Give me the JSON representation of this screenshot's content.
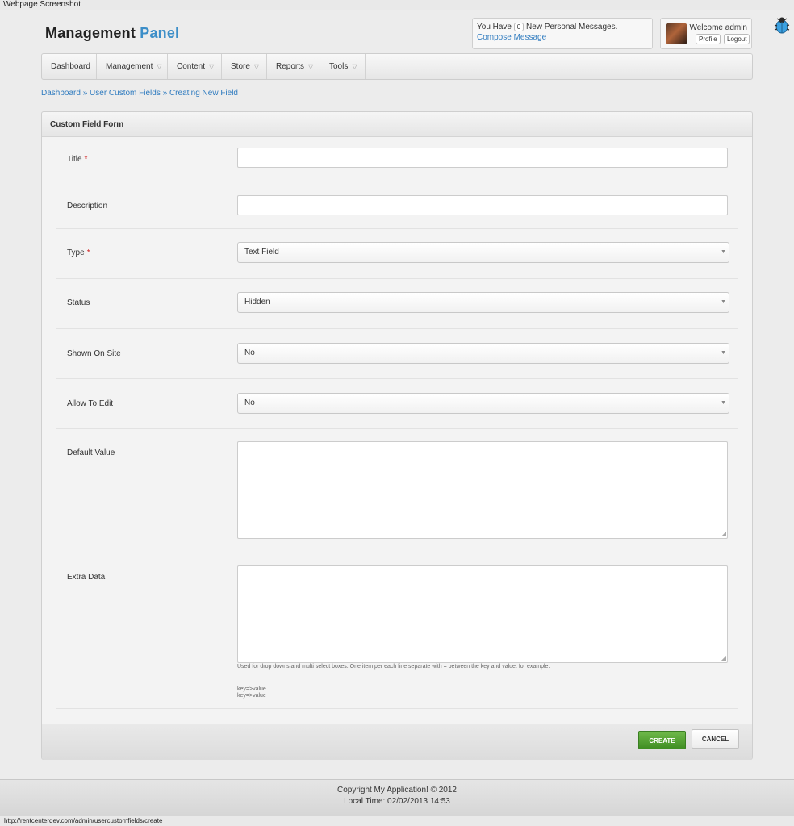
{
  "capture": {
    "title": "Webpage Screenshot",
    "url": "http://rentcenterdev.com/admin/usercustomfields/create"
  },
  "header": {
    "brand_main": "Management",
    "brand_accent": "Panel",
    "messages": {
      "prefix": "You Have",
      "count": "0",
      "suffix": "New Personal Messages.",
      "compose": "Compose Message"
    },
    "user": {
      "welcome": "Welcome admin",
      "profile": "Profile",
      "logout": "Logout"
    },
    "icons": [
      "bug-icon",
      "chevron-down-icon",
      "avatar"
    ]
  },
  "nav": {
    "items": [
      "Dashboard",
      "Management",
      "Content",
      "Store",
      "Reports",
      "Tools"
    ]
  },
  "breadcrumb": "Dashboard » User Custom Fields » Creating New Field",
  "form": {
    "title": "Custom Field Form",
    "required_mark": "*",
    "fields": {
      "title": {
        "label": "Title",
        "value": ""
      },
      "description": {
        "label": "Description",
        "value": ""
      },
      "type": {
        "label": "Type",
        "value": "Text Field"
      },
      "status": {
        "label": "Status",
        "value": "Hidden"
      },
      "shown_on_site": {
        "label": "Shown On Site",
        "value": "No"
      },
      "allow_to_edit": {
        "label": "Allow To Edit",
        "value": "No"
      },
      "default_value": {
        "label": "Default Value",
        "value": ""
      },
      "extra_data": {
        "label": "Extra Data",
        "value": "",
        "hint": "Used for drop downs and multi select boxes. One item per each line separate with = between the key and value. for example:",
        "example_1": "key=>value",
        "example_2": "key=>value"
      }
    },
    "buttons": {
      "create": "CREATE",
      "cancel": "CANCEL"
    }
  },
  "footer": {
    "copyright": "Copyright My Application! © 2012",
    "local_time": "Local Time: 02/02/2013 14:53"
  },
  "colors": {
    "accent": "#3c8ec8",
    "link": "#2f7bbf",
    "required": "#d02323",
    "create_button": "#4f9d2e"
  }
}
